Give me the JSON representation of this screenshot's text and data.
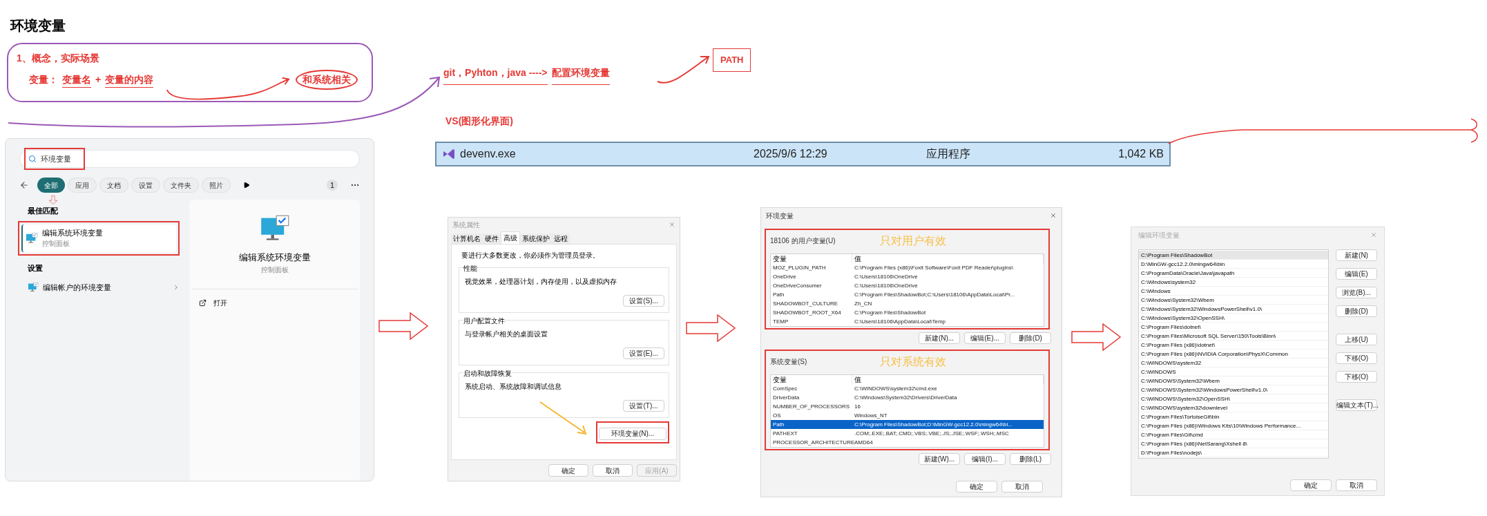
{
  "title": "环境变量",
  "notes": {
    "line_1": "1、概念，实际场景",
    "label": "变量：",
    "term_1": "变量名",
    "plus": "+",
    "term_2": "变量的内容",
    "bubble": "和系统相关"
  },
  "flow": {
    "languages": "git，Pyhton，java ---->",
    "target": "配置环境变量",
    "result": "PATH"
  },
  "vs_label": "VS(图形化界面)",
  "file_row": {
    "name": "devenv.exe",
    "date": "2025/9/6 12:29",
    "type": "应用程序",
    "size": "1,042 KB",
    "selected": true
  },
  "search_panel": {
    "query": "环境变量",
    "filters": [
      {
        "label": "全部",
        "selected": true
      },
      {
        "label": "应用",
        "selected": false
      },
      {
        "label": "文档",
        "selected": false
      },
      {
        "label": "设置",
        "selected": false
      },
      {
        "label": "文件夹",
        "selected": false
      },
      {
        "label": "照片",
        "selected": false
      }
    ],
    "count": "1",
    "best_match_heading": "最佳匹配",
    "best_match": {
      "title": "编辑系统环境变量",
      "subtitle": "控制面板",
      "selected": true
    },
    "settings_heading": "设置",
    "settings_item": "编辑帐户的环境变量",
    "preview": {
      "title": "编辑系统环境变量",
      "subtitle": "控制面板",
      "action": "打开"
    }
  },
  "system_properties": {
    "title": "系统属性",
    "tabs": [
      {
        "label": "计算机名",
        "selected": false
      },
      {
        "label": "硬件",
        "selected": false
      },
      {
        "label": "高级",
        "selected": true
      },
      {
        "label": "系统保护",
        "selected": false
      },
      {
        "label": "远程",
        "selected": false
      }
    ],
    "notice": "要进行大多数更改，你必须作为管理员登录。",
    "groups": [
      {
        "heading": "性能",
        "text": "视觉效果，处理器计划，内存使用，以及虚拟内存",
        "button": "设置(S)..."
      },
      {
        "heading": "用户配置文件",
        "text": "与登录帐户相关的桌面设置",
        "button": "设置(E)..."
      },
      {
        "heading": "启动和故障恢复",
        "text": "系统启动、系统故障和调试信息",
        "button": "设置(T)..."
      }
    ],
    "env_button": "环境变量(N)...",
    "buttons": [
      {
        "label": "确定",
        "disabled": false
      },
      {
        "label": "取消",
        "disabled": false
      },
      {
        "label": "应用(A)",
        "disabled": true
      }
    ]
  },
  "env_dialog": {
    "title": "环境变量",
    "sections": [
      {
        "heading": "18106 的用户变量(U)",
        "note": "只对用户有效",
        "columns": [
          "变量",
          "值"
        ],
        "rows": [
          {
            "name": "MOZ_PLUGIN_PATH",
            "value": "C:\\Program Files (x86)\\Foxit Software\\Foxit PDF Reader\\plugins\\",
            "selected": false
          },
          {
            "name": "OneDrive",
            "value": "C:\\Users\\18106\\OneDrive",
            "selected": false
          },
          {
            "name": "OneDriveConsumer",
            "value": "C:\\Users\\18106\\OneDrive",
            "selected": false
          },
          {
            "name": "Path",
            "value": "C:\\Program Files\\ShadowBot;C:\\Users\\18106\\AppData\\Local\\Pr...",
            "selected": false
          },
          {
            "name": "SHADOWBOT_CULTURE",
            "value": "Zh_CN",
            "selected": false
          },
          {
            "name": "SHADOWBOT_ROOT_X64",
            "value": "C:\\Program Files\\ShadowBot",
            "selected": false
          },
          {
            "name": "TEMP",
            "value": "C:\\Users\\18106\\AppData\\Local\\Temp",
            "selected": false
          }
        ],
        "buttons": [
          "新建(N)...",
          "编辑(E)...",
          "删除(D)"
        ]
      },
      {
        "heading": "系统变量(S)",
        "note": "只对系统有效",
        "columns": [
          "变量",
          "值"
        ],
        "rows": [
          {
            "name": "ComSpec",
            "value": "C:\\WINDOWS\\system32\\cmd.exe",
            "selected": false
          },
          {
            "name": "DriverData",
            "value": "C:\\Windows\\System32\\Drivers\\DriverData",
            "selected": false
          },
          {
            "name": "NUMBER_OF_PROCESSORS",
            "value": "16",
            "selected": false
          },
          {
            "name": "OS",
            "value": "Windows_NT",
            "selected": false
          },
          {
            "name": "Path",
            "value": "C:\\Program Files\\ShadowBot;D:\\MinGW-gcc12.2.0\\mingw64\\bi...",
            "selected": true
          },
          {
            "name": "PATHEXT",
            "value": ".COM;.EXE;.BAT;.CMD;.VBS;.VBE;.JS;.JSE;.WSF;.WSH;.MSC",
            "selected": false
          },
          {
            "name": "PROCESSOR_ARCHITECTURE",
            "value": "AMD64",
            "selected": false
          }
        ],
        "buttons": [
          "新建(W)...",
          "编辑(I)...",
          "删除(L)"
        ]
      }
    ],
    "buttons": [
      "确定",
      "取消"
    ]
  },
  "edit_dialog": {
    "title": "编辑环境变量",
    "entries": [
      {
        "text": "C:\\Program Files\\ShadowBot",
        "selected": true
      },
      {
        "text": "D:\\MinGW-gcc12.2.0\\mingw64\\bin",
        "selected": false
      },
      {
        "text": "C:\\ProgramData\\Oracle\\Java\\javapath",
        "selected": false
      },
      {
        "text": "C:\\Windows\\system32",
        "selected": false
      },
      {
        "text": "C:\\Windows",
        "selected": false
      },
      {
        "text": "C:\\Windows\\System32\\Wbem",
        "selected": false
      },
      {
        "text": "C:\\Windows\\System32\\WindowsPowerShell\\v1.0\\",
        "selected": false
      },
      {
        "text": "C:\\Windows\\System32\\OpenSSH\\",
        "selected": false
      },
      {
        "text": "C:\\Program Files\\dotnet\\",
        "selected": false
      },
      {
        "text": "C:\\Program Files\\Microsoft SQL Server\\150\\Tools\\Binn\\",
        "selected": false
      },
      {
        "text": "C:\\Program Files (x86)\\dotnet\\",
        "selected": false
      },
      {
        "text": "C:\\Program Files (x86)\\NVIDIA Corporation\\PhysX\\Common",
        "selected": false
      },
      {
        "text": "C:\\WINDOWS\\system32",
        "selected": false
      },
      {
        "text": "C:\\WINDOWS",
        "selected": false
      },
      {
        "text": "C:\\WINDOWS\\System32\\Wbem",
        "selected": false
      },
      {
        "text": "C:\\WINDOWS\\System32\\WindowsPowerShell\\v1.0\\",
        "selected": false
      },
      {
        "text": "C:\\WINDOWS\\System32\\OpenSSH\\",
        "selected": false
      },
      {
        "text": "C:\\WINDOWS\\system32\\downlevel",
        "selected": false
      },
      {
        "text": "C:\\Program Files\\TortoiseGit\\bin",
        "selected": false
      },
      {
        "text": "C:\\Program Files (x86)\\Windows Kits\\10\\Windows Performance...",
        "selected": false
      },
      {
        "text": "C:\\Program Files\\Git\\cmd",
        "selected": false
      },
      {
        "text": "C:\\Program Files (x86)\\NetSarang\\Xshell 8\\",
        "selected": false
      },
      {
        "text": "D:\\Program Files\\nodejs\\",
        "selected": false
      }
    ],
    "buttons": [
      {
        "label": "新建(N)",
        "kind": "top"
      },
      {
        "label": "编辑(E)",
        "kind": "top"
      },
      {
        "label": "浏览(B)...",
        "kind": "top"
      },
      {
        "label": "删除(D)",
        "kind": "top"
      },
      {
        "label": "上移(U)",
        "kind": "move"
      },
      {
        "label": "下移(O)",
        "kind": "move"
      },
      {
        "label": "下移(O)",
        "kind": "move"
      },
      {
        "label": "编辑文本(T)...",
        "kind": "text"
      }
    ],
    "footer": [
      "确定",
      "取消"
    ]
  }
}
